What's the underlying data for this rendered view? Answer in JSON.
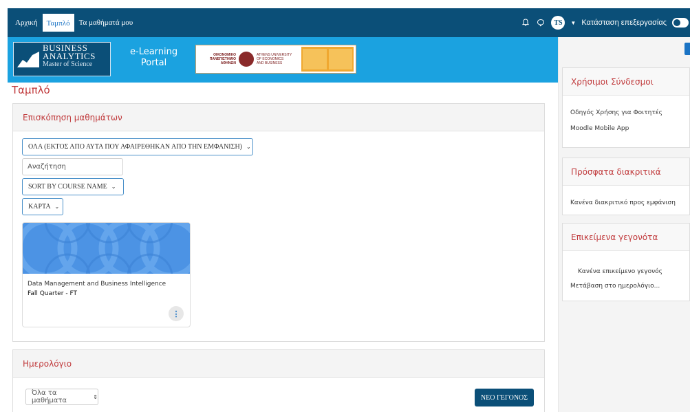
{
  "navbar": {
    "items": [
      {
        "label": "Αρχική"
      },
      {
        "label": "Ταμπλό"
      },
      {
        "label": "Τα μαθήματά μου"
      }
    ],
    "user_initials": "TS",
    "edit_mode_label": "Κατάσταση επεξεργασίας"
  },
  "banner": {
    "logo_line1": "BUSINESS",
    "logo_line2": "ANALYTICS",
    "logo_line3": "Master of Science",
    "portal_line1": "e-Learning",
    "portal_line2": "Portal",
    "aueb_line1": "ΟΙΚΟΝΟΜΙΚΟ",
    "aueb_line2": "ΠΑΝΕΠΙΣΤΗΜΙΟ",
    "aueb_line3": "ΑΘΗΝΩΝ",
    "aueb_en1": "ATHENS UNIVERSITY",
    "aueb_en2": "OF ECONOMICS",
    "aueb_en3": "AND BUSINESS"
  },
  "main": {
    "page_title": "Ταμπλό",
    "overview": {
      "title": "Επισκόπηση μαθημάτων",
      "filter_label": "ΟΛΑ (ΕΚΤΟΣ ΑΠΟ ΑΥΤΑ ΠΟΥ ΑΦΑΙΡΕΘΗΚΑΝ ΑΠΟ ΤΗΝ ΕΜΦΑΝΙΣΗ)",
      "search_placeholder": "Αναζήτηση",
      "sort_label": "SORT BY COURSE NAME",
      "view_label": "ΚΑΡΤΑ",
      "course": {
        "name": "Data Management and Business Intelligence",
        "term": "Fall Quarter - FT"
      }
    },
    "calendar": {
      "title": "Ημερολόγιο",
      "course_select": "Όλα τα μαθήματα",
      "new_event_label": "ΝΕΟ ΓΕΓΟΝΟΣ"
    }
  },
  "sidebar": {
    "useful_links": {
      "title": "Χρήσιμοι Σύνδεσμοι",
      "links": [
        "Οδηγός Χρήσης για Φοιτητές",
        "Moodle Mobile App"
      ]
    },
    "badges": {
      "title": "Πρόσφατα διακριτικά",
      "empty": "Κανένα διακριτικό προς εμφάνιση"
    },
    "events": {
      "title": "Επικείμενα γεγονότα",
      "empty": "Κανένα επικείμενο γεγονός",
      "calendar_link": "Μετάβαση στο ημερολόγιο..."
    }
  },
  "colors": {
    "navbar_bg": "#0b4f78",
    "banner_bg": "#1ba2e0",
    "heading_red": "#c0393b",
    "accent_blue": "#1a73c4"
  }
}
